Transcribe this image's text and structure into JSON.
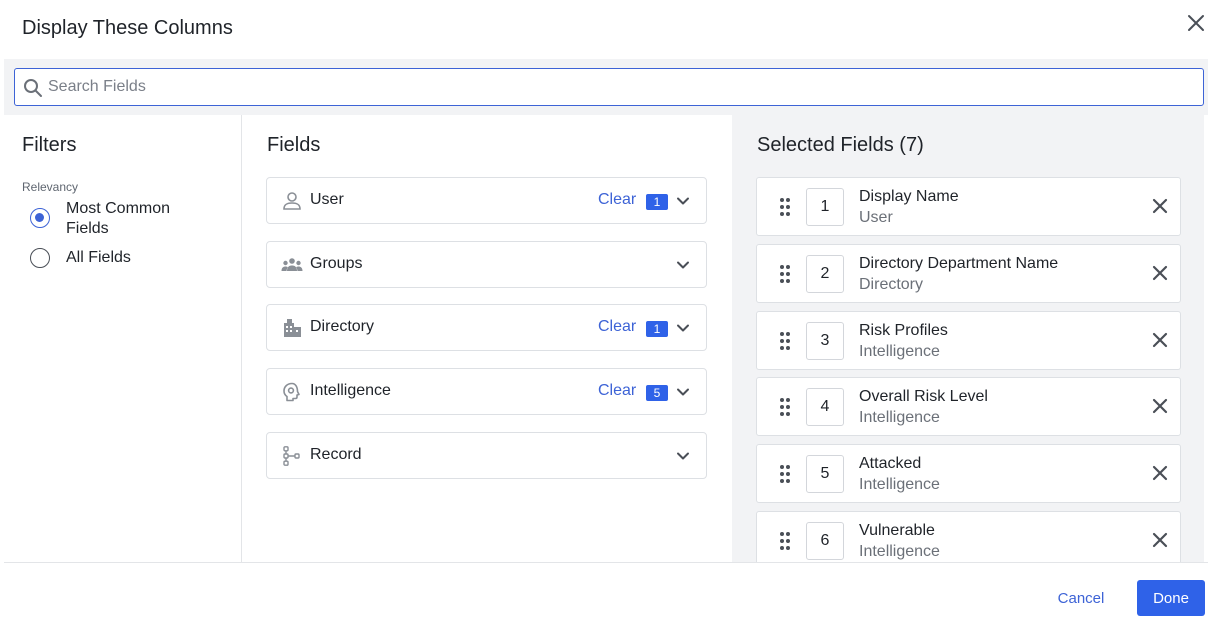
{
  "dialog": {
    "title": "Display These Columns"
  },
  "search": {
    "placeholder": "Search Fields",
    "value": ""
  },
  "filters": {
    "heading": "Filters",
    "group_label": "Relevancy",
    "options": [
      {
        "label": "Most Common Fields",
        "selected": true
      },
      {
        "label": "All Fields",
        "selected": false
      }
    ]
  },
  "fields": {
    "heading": "Fields",
    "groups": [
      {
        "label": "User",
        "icon": "user-icon",
        "clear": "Clear",
        "count": "1"
      },
      {
        "label": "Groups",
        "icon": "groups-icon",
        "clear": "",
        "count": ""
      },
      {
        "label": "Directory",
        "icon": "building-icon",
        "clear": "Clear",
        "count": "1"
      },
      {
        "label": "Intelligence",
        "icon": "brain-icon",
        "clear": "Clear",
        "count": "5"
      },
      {
        "label": "Record",
        "icon": "record-tree-icon",
        "clear": "",
        "count": ""
      }
    ]
  },
  "selected": {
    "heading": "Selected Fields (7)",
    "items": [
      {
        "order": "1",
        "name": "Display Name",
        "category": "User"
      },
      {
        "order": "2",
        "name": "Directory Department Name",
        "category": "Directory"
      },
      {
        "order": "3",
        "name": "Risk Profiles",
        "category": "Intelligence"
      },
      {
        "order": "4",
        "name": "Overall Risk Level",
        "category": "Intelligence"
      },
      {
        "order": "5",
        "name": "Attacked",
        "category": "Intelligence"
      },
      {
        "order": "6",
        "name": "Vulnerable",
        "category": "Intelligence"
      }
    ]
  },
  "footer": {
    "cancel": "Cancel",
    "done": "Done"
  },
  "colors": {
    "accent": "#2f62e8",
    "link": "#3d63d6",
    "panel_bg": "#f2f3f5"
  }
}
